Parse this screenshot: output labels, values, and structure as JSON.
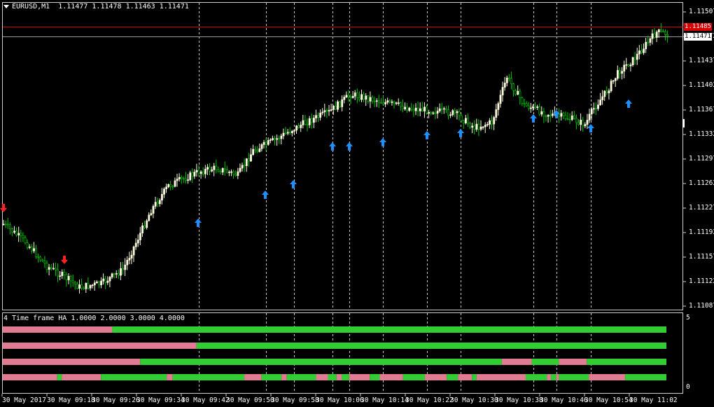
{
  "window": {
    "symbol_label": "EURUSD,M1",
    "ohlc_label": "1.11477 1.11478 1.11463 1.11471"
  },
  "price_axis": {
    "labels": [
      "1.11507",
      "1.11472",
      "1.11437",
      "1.11402",
      "1.11367",
      "1.11332",
      "1.11297",
      "1.11262",
      "1.11227",
      "1.11192",
      "1.11157",
      "1.11122",
      "1.11087"
    ],
    "ask_tag": "1.11485",
    "bid_tag": "1.11471"
  },
  "time_axis": {
    "labels": [
      "30 May 2017",
      "30 May 09:18",
      "30 May 09:26",
      "30 May 09:34",
      "30 May 09:42",
      "30 May 09:50",
      "30 May 09:58",
      "30 May 10:06",
      "30 May 10:14",
      "30 May 10:22",
      "30 May 10:30",
      "30 May 10:38",
      "30 May 10:46",
      "30 May 10:54",
      "30 May 11:02"
    ]
  },
  "indicator": {
    "title": "4 Time frame HA 1.0000 2.0000 3.0000 4.0000",
    "scale_top": "5",
    "scale_bottom": "0",
    "bars": [
      [
        [
          0,
          0.165,
          "bear"
        ],
        [
          0.165,
          1,
          "bull"
        ]
      ],
      [
        [
          0,
          0.292,
          "bear"
        ],
        [
          0.292,
          1,
          "bull"
        ]
      ],
      [
        [
          0,
          0.207,
          "bear"
        ],
        [
          0.207,
          0.752,
          "bull"
        ],
        [
          0.752,
          0.797,
          "bear"
        ],
        [
          0.797,
          0.838,
          "bull"
        ],
        [
          0.838,
          0.88,
          "bear"
        ],
        [
          0.88,
          1,
          "bull"
        ]
      ],
      [
        [
          0,
          0.082,
          "bear"
        ],
        [
          0.082,
          0.089,
          "bull"
        ],
        [
          0.089,
          0.148,
          "bear"
        ],
        [
          0.148,
          0.247,
          "bull"
        ],
        [
          0.247,
          0.256,
          "bear"
        ],
        [
          0.256,
          0.364,
          "bull"
        ],
        [
          0.364,
          0.39,
          "bear"
        ],
        [
          0.39,
          0.42,
          "bull"
        ],
        [
          0.42,
          0.428,
          "bear"
        ],
        [
          0.428,
          0.472,
          "bull"
        ],
        [
          0.472,
          0.49,
          "bear"
        ],
        [
          0.49,
          0.503,
          "bull"
        ],
        [
          0.503,
          0.511,
          "bear"
        ],
        [
          0.511,
          0.522,
          "bull"
        ],
        [
          0.522,
          0.553,
          "bear"
        ],
        [
          0.553,
          0.568,
          "bull"
        ],
        [
          0.568,
          0.603,
          "bear"
        ],
        [
          0.603,
          0.636,
          "bull"
        ],
        [
          0.636,
          0.669,
          "bear"
        ],
        [
          0.669,
          0.686,
          "bull"
        ],
        [
          0.686,
          0.707,
          "bear"
        ],
        [
          0.707,
          0.714,
          "bull"
        ],
        [
          0.714,
          0.788,
          "bear"
        ],
        [
          0.788,
          0.82,
          "bull"
        ],
        [
          0.82,
          0.826,
          "bear"
        ],
        [
          0.826,
          0.834,
          "bull"
        ],
        [
          0.834,
          0.838,
          "bear"
        ],
        [
          0.838,
          0.883,
          "bull"
        ],
        [
          0.883,
          0.938,
          "bear"
        ],
        [
          0.938,
          1,
          "bull"
        ]
      ]
    ]
  },
  "colors": {
    "background": "#000000",
    "bull_candle": "#ffffe0",
    "bear_candle": "#00c800",
    "grid": "#c8c8c8",
    "ask_line": "#d60000",
    "bid_line": "#ffffff",
    "signal_up": "#1e90ff",
    "signal_down": "#ff2020",
    "ha_bull": "#32cd32",
    "ha_bear": "#e07b91"
  },
  "signals": {
    "up_icon": "arrow-up-icon",
    "down_icon": "arrow-down-icon"
  }
}
